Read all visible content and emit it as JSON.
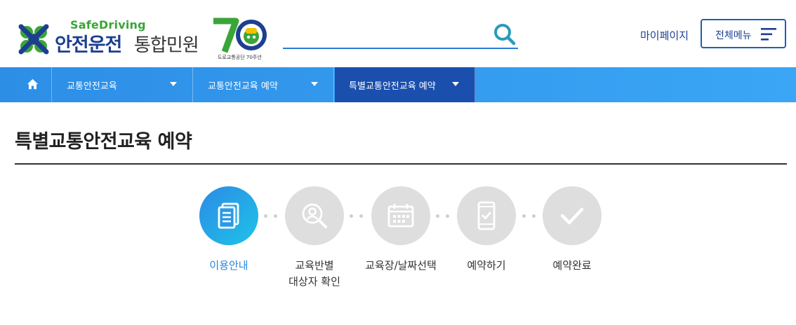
{
  "header": {
    "logo": {
      "brand_en": "SafeDriving",
      "brand_main": "안전운전",
      "brand_sub": "통합민원",
      "anniversary_caption": "도로교통공단 70주년"
    },
    "search": {
      "placeholder": "",
      "value": ""
    },
    "mypage_label": "마이페이지",
    "allmenu_label": "전체메뉴"
  },
  "nav": {
    "items": [
      {
        "label": "교통안전교육",
        "active": false
      },
      {
        "label": "교통안전교육 예약",
        "active": false
      },
      {
        "label": "특별교통안전교육 예약",
        "active": true
      }
    ]
  },
  "main": {
    "title": "특별교통안전교육 예약",
    "steps": [
      {
        "label_1": "이용안내",
        "label_2": "",
        "icon": "document-icon",
        "active": true
      },
      {
        "label_1": "교육반별",
        "label_2": "대상자 확인",
        "icon": "user-search-icon",
        "active": false
      },
      {
        "label_1": "교육장/날짜선택",
        "label_2": "",
        "icon": "calendar-icon",
        "active": false
      },
      {
        "label_1": "예약하기",
        "label_2": "",
        "icon": "mobile-check-icon",
        "active": false
      },
      {
        "label_1": "예약완료",
        "label_2": "",
        "icon": "checkmark-icon",
        "active": false
      }
    ]
  },
  "colors": {
    "brand_navy": "#1d3f8f",
    "brand_green": "#3aa538",
    "nav_blue": "#2d8ee6",
    "nav_active": "#1a4fae",
    "step_active": "#2c8be6",
    "step_inactive": "#dedede"
  }
}
